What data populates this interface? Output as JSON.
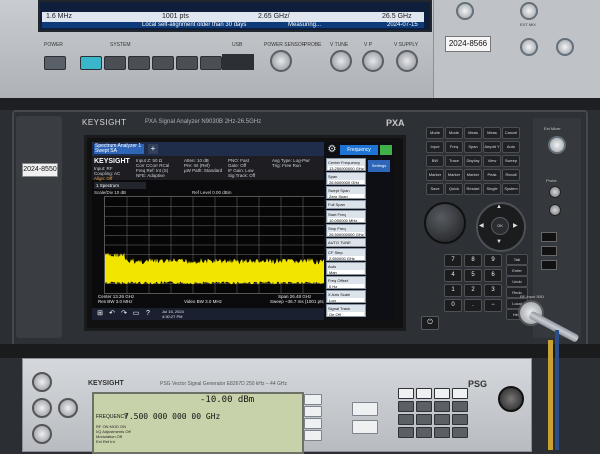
{
  "top_instrument": {
    "status_left": "1.6 MHz",
    "status_mid_1": "1001 pts",
    "status_mid_2": "2.65 GHz/",
    "status_right": "26.5 GHz",
    "footer_text": "Local self-alignment older than 30 days",
    "footer_measuring": "Measuring...",
    "footer_date": "2024-07-15",
    "power_label": "POWER",
    "system_label": "SYSTEM",
    "usb_label": "USB",
    "power_sensor_label": "POWER SENSOR",
    "probe_label": "PROBE",
    "v_tune_label": "V TUNE",
    "vp_label": "V P",
    "v_supply_label": "V SUPPLY",
    "asset_tag": "2024-8566",
    "ext_mix_label": "EXT MIX"
  },
  "pxa": {
    "brand": "KEYSIGHT",
    "model_text": "PXA Signal Analyzer  N9030B  2Hz-26.5GHz",
    "name": "PXA",
    "asset_tag": "2024-8550",
    "power_glyph": "⏻",
    "screen": {
      "tab_label": "Spectrum Analyzer 1 Swept SA",
      "add_tab": "+",
      "logo": "KEYSIGHT",
      "info_col1": [
        "Input: RF",
        "Coupling: AC",
        "Align: Off"
      ],
      "info_col2": [
        "Input Z: 50 Ω",
        "Corr CCorr RCal",
        "Freq Ref: Int (S)",
        "NFE: Adaptive"
      ],
      "info_col3": [
        "Atten: 10 dB",
        "Pre: Int (Ref)",
        "µW Path: Standard"
      ],
      "info_col4": [
        "PNO: Fast",
        "Gate: Off",
        "IF Gain: Low",
        "Sig Track: Off"
      ],
      "info_col5": [
        "Avg Type: Log-Pwr",
        "Trig: Free Run"
      ],
      "trace_label": "1 Spectrum",
      "scale": "Scale/Div 10 dB",
      "ref_level": "Ref Level 0.00 dBm",
      "center": "Center 13.26 GHz",
      "res_bw": "Res BW 3.0 MHz",
      "video_bw": "Video BW 3.0 MHz",
      "span": "Span 26.48 GHz",
      "sweep": "Sweep ~36.7 ms (1001 pts)",
      "date_line1": "Jul 15, 2024",
      "date_line2": "4:30:27 PM",
      "taskbar_icons": [
        "⊞",
        "↶",
        "↷",
        "▭",
        "?"
      ],
      "menu": {
        "gear": "⚙",
        "title": "Frequency",
        "side_tab": "Settings",
        "items": [
          {
            "label": "Center Frequency",
            "value": "13.250000000 GHz"
          },
          {
            "label": "Span",
            "value": "26.5000000 GHz"
          },
          {
            "label": "Swept Span",
            "value": "Zero Span"
          },
          {
            "label": "Full Span",
            "value": ""
          },
          {
            "label": "Start Freq",
            "value": "10.000000 MHz"
          },
          {
            "label": "Stop Freq",
            "value": "26.500000000 GHz"
          },
          {
            "label": "AUTO TUNE",
            "value": ""
          },
          {
            "label": "CF Step",
            "value": "2.650000 GHz"
          },
          {
            "label": "Auto",
            "value": "Man"
          },
          {
            "label": "Freq Offset",
            "value": "0 Hz"
          },
          {
            "label": "X Axis Scale",
            "value": "Log"
          },
          {
            "label": "Signal Track",
            "value": "On  Off"
          }
        ]
      }
    },
    "keys_top": [
      "Mode Preset",
      "Mode Setup",
      "Meas",
      "Meas Setup",
      "Cancel Esc",
      "Input Output",
      "Freq",
      "Span",
      "Amptd Y Scale",
      "Auto Couple",
      "BW",
      "Trace",
      "Display",
      "View",
      "Sweep",
      "Marker",
      "Marker To",
      "Marker Func",
      "Peak Search",
      "Recall",
      "Save",
      "Quick Save",
      "Restart",
      "Single",
      "System"
    ],
    "keys_num": [
      "7",
      "8",
      "9",
      "4",
      "5",
      "6",
      "1",
      "2",
      "3",
      "0",
      ".",
      "−"
    ],
    "keys_side": [
      "Tab",
      "Enter",
      "Undo",
      "Redo",
      "Local",
      "Help"
    ],
    "dpad_enter": "OK",
    "label_ext_mixer": "Ext Mixer",
    "label_probe": "Probe",
    "label_rf_input": "RF Input 50Ω"
  },
  "psg": {
    "brand": "KEYSIGHT",
    "subtitle": "PSG Vector Signal Generator  E8267D  250 kHz – 44 GHz",
    "name": "PSG",
    "amplitude": "-10.00 dBm",
    "freq_label": "FREQUENCY",
    "frequency": "7.500 000 000 00 GHz",
    "lines": [
      "RF ON   MOD ON",
      "I/Q Adjustments   Off",
      "Modulation   Off",
      "Ext Ref   Int"
    ]
  },
  "colors": {
    "trace": "#f2e600",
    "grid": "#6e6e6e",
    "accent": "#1f73d4"
  }
}
